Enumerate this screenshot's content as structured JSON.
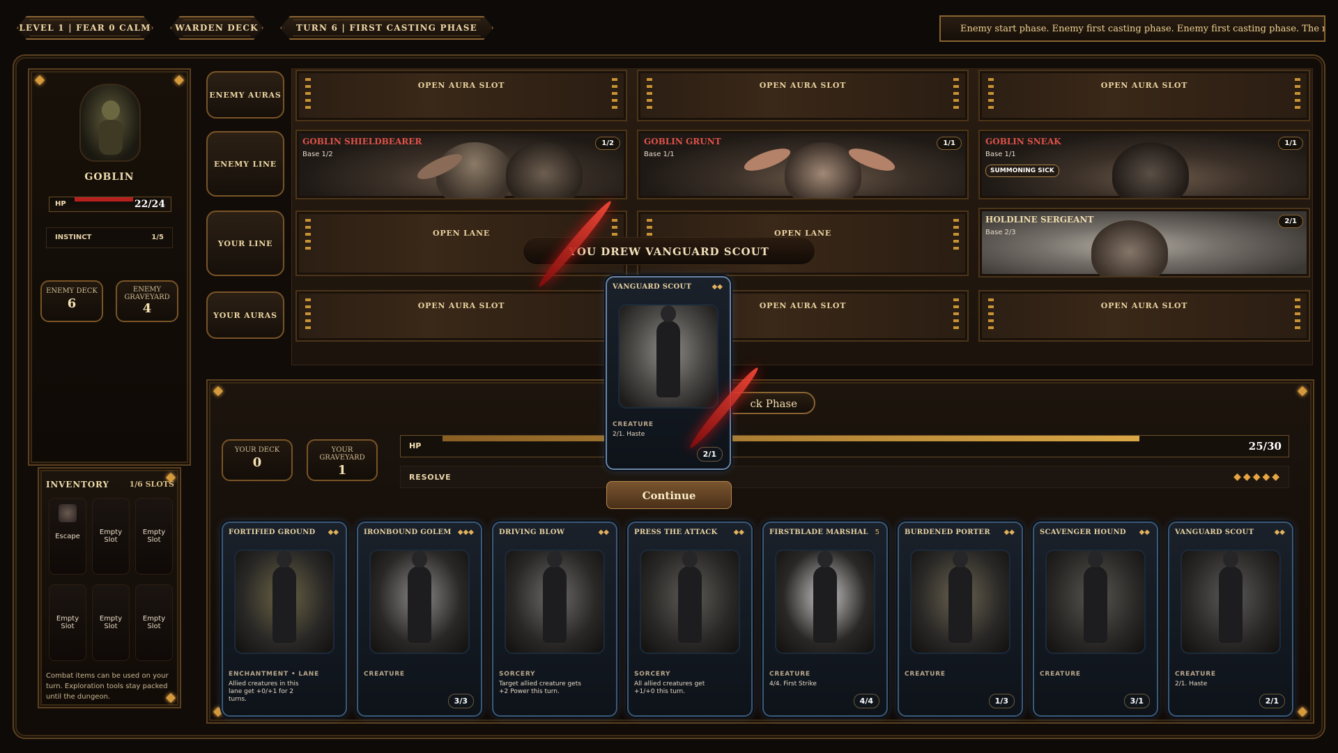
{
  "top_bar": {
    "level_label": "LEVEL 1 | FEAR 0 CALM",
    "deck_label": "WARDEN DECK",
    "turn_label": "TURN 6 | FIRST CASTING PHASE",
    "ticker": "Enemy start phase. Enemy first casting phase. Enemy first casting phase. The monst"
  },
  "enemy": {
    "name": "GOBLIN",
    "hp_label": "HP",
    "hp_value": "22/24",
    "hp_fraction": 0.917,
    "instinct_label": "INSTINCT",
    "instinct_value": "1/5",
    "deck_label": "ENEMY DECK",
    "deck_value": "6",
    "graveyard_label": "ENEMY GRAVEYARD",
    "graveyard_value": "4"
  },
  "rows": {
    "enemy_auras": "ENEMY AURAS",
    "enemy_line": "ENEMY LINE",
    "your_line": "YOUR LINE",
    "your_auras": "YOUR AURAS",
    "open_aura": "OPEN AURA SLOT",
    "open_lane": "OPEN LANE"
  },
  "enemy_units": [
    {
      "name": "GOBLIN SHIELDBEARER",
      "base": "Base 1/2",
      "stats": "1/2"
    },
    {
      "name": "GOBLIN GRUNT",
      "base": "Base 1/1",
      "stats": "1/1"
    },
    {
      "name": "GOBLIN SNEAK",
      "base": "Base 1/1",
      "stats": "1/1",
      "badge": "SUMMONING SICK"
    }
  ],
  "your_units": [
    {
      "name": "HOLDLINE SERGEANT",
      "base": "Base 2/3",
      "stats": "2/1"
    }
  ],
  "draw_banner": "YOU DREW VANGUARD SCOUT",
  "drawn_card": {
    "name": "VANGUARD SCOUT",
    "type": "CREATURE",
    "desc": "2/1. Haste",
    "stats": "2/1",
    "cost": "◆◆"
  },
  "continue_label": "Continue",
  "phase_label": "ck Phase",
  "player": {
    "deck_label": "YOUR DECK",
    "deck_value": "0",
    "graveyard_label": "YOUR GRAVEYARD",
    "graveyard_value": "1",
    "hp_label": "HP",
    "hp_value": "25/30",
    "hp_fraction": 0.833,
    "resolve_label": "RESOLVE",
    "resolve_pips": "◆◆◆◆◆"
  },
  "inventory": {
    "title": "INVENTORY",
    "slots_label": "1/6 SLOTS",
    "items": [
      "Escape",
      "Empty Slot",
      "Empty Slot",
      "Empty Slot",
      "Empty Slot",
      "Empty Slot"
    ],
    "note": "Combat items can be used on your turn. Exploration tools stay packed until the dungeon."
  },
  "hand": [
    {
      "name": "FORTIFIED GROUND",
      "cost": "◆◆",
      "type": "ENCHANTMENT • LANE",
      "desc": "Allied creatures in this lane get +0/+1 for 2 turns.",
      "stats": "",
      "art": "#6b6444"
    },
    {
      "name": "IRONBOUND GOLEM",
      "cost": "◆◆◆",
      "type": "CREATURE",
      "desc": "",
      "stats": "3/3",
      "art": "#8a8a88"
    },
    {
      "name": "DRIVING BLOW",
      "cost": "◆◆",
      "type": "SORCERY",
      "desc": "Target allied creature gets +2 Power this turn.",
      "stats": "",
      "art": "#6c6c6a"
    },
    {
      "name": "PRESS THE ATTACK",
      "cost": "◆◆",
      "type": "SORCERY",
      "desc": "All allied creatures get +1/+0 this turn.",
      "stats": "",
      "art": "#5e5c58"
    },
    {
      "name": "FIRSTBLADE MARSHAL",
      "cost": "5",
      "type": "CREATURE",
      "desc": "4/4. First Strike",
      "stats": "4/4",
      "art": "#c9c9c9"
    },
    {
      "name": "BURDENED PORTER",
      "cost": "◆◆",
      "type": "CREATURE",
      "desc": "",
      "stats": "1/3",
      "art": "#6a6350"
    },
    {
      "name": "SCAVENGER HOUND",
      "cost": "◆◆",
      "type": "CREATURE",
      "desc": "",
      "stats": "3/1",
      "art": "#565650"
    },
    {
      "name": "VANGUARD SCOUT",
      "cost": "◆◆",
      "type": "CREATURE",
      "desc": "2/1. Haste",
      "stats": "2/1",
      "art": "#5a5a58"
    }
  ],
  "colors": {
    "gold": "#c89235",
    "enemy_name": "#e0524a",
    "hp_red": "#b8201e",
    "hp_gold": "#d9a746"
  }
}
